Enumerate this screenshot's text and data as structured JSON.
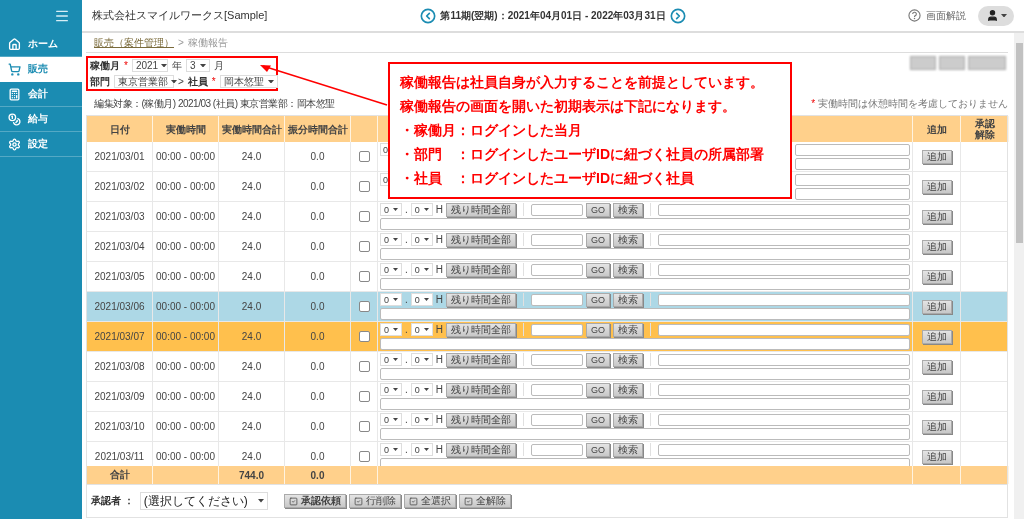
{
  "sidebar": {
    "items": [
      {
        "label": "ホーム",
        "selected": false
      },
      {
        "label": "販売",
        "selected": true
      },
      {
        "label": "会計",
        "selected": false
      },
      {
        "label": "給与",
        "selected": false
      },
      {
        "label": "設定",
        "selected": false
      }
    ]
  },
  "header": {
    "company": "株式会社スマイルワークス[Sample]",
    "period": "第11期(翌期)：2021年04月01日 - 2022年03月31日",
    "help": "画面解説"
  },
  "breadcrumb": {
    "link": "販売（案件管理）",
    "separator": ">",
    "current": "稼働報告"
  },
  "filters": {
    "month_label": "稼働月",
    "month_required": "*",
    "year": "2021",
    "year_unit": "年",
    "month": "3",
    "month_unit": "月",
    "dept_label": "部門",
    "dept": "東京営業部",
    "separator": ">",
    "employee_label": "社員",
    "employee_required": "*",
    "employee": "岡本悠聖"
  },
  "edit_target": "編集対象：(稼働月) 2021/03 (社員) 東京営業部：岡本悠聖",
  "note": {
    "mark": "*",
    "text": "実働時間は休憩時間を考慮しておりません"
  },
  "table": {
    "columns": [
      {
        "label": "日付"
      },
      {
        "label": "実働時間"
      },
      {
        "label": "実働時間合計"
      },
      {
        "label": "振分時間合計"
      },
      {
        "label": "追加"
      },
      {
        "label": "承認解除"
      }
    ],
    "rows": [
      {
        "date": "2021/03/01",
        "work_time": "00:00 - 00:00",
        "total": "24.0",
        "allocated": "0.0",
        "checked": false,
        "hovered": false,
        "selected": false,
        "hours": "0",
        "add_button": "追加"
      },
      {
        "date": "2021/03/02",
        "work_time": "00:00 - 00:00",
        "total": "24.0",
        "allocated": "0.0",
        "checked": false,
        "hovered": false,
        "selected": false,
        "hours": "0",
        "add_button": "追加"
      },
      {
        "date": "2021/03/03",
        "work_time": "00:00 - 00:00",
        "total": "24.0",
        "allocated": "0.0",
        "checked": false,
        "hovered": false,
        "selected": false,
        "hours": "0",
        "dot": ".",
        "minutes": "0",
        "unit": "H",
        "fill_button": "残り時間全部",
        "go_button": "GO",
        "search_button": "検索",
        "add_button": "追加"
      },
      {
        "date": "2021/03/04",
        "work_time": "00:00 - 00:00",
        "total": "24.0",
        "allocated": "0.0",
        "checked": false,
        "hovered": false,
        "selected": false,
        "hours": "0",
        "dot": ".",
        "minutes": "0",
        "unit": "H",
        "fill_button": "残り時間全部",
        "go_button": "GO",
        "search_button": "検索",
        "add_button": "追加"
      },
      {
        "date": "2021/03/05",
        "work_time": "00:00 - 00:00",
        "total": "24.0",
        "allocated": "0.0",
        "checked": false,
        "hovered": false,
        "selected": false,
        "hours": "0",
        "dot": ".",
        "minutes": "0",
        "unit": "H",
        "fill_button": "残り時間全部",
        "go_button": "GO",
        "search_button": "検索",
        "add_button": "追加"
      },
      {
        "date": "2021/03/06",
        "work_time": "00:00 - 00:00",
        "total": "24.0",
        "allocated": "0.0",
        "checked": false,
        "hovered": true,
        "selected": false,
        "hours": "0",
        "dot": ".",
        "minutes": "0",
        "unit": "H",
        "fill_button": "残り時間全部",
        "go_button": "GO",
        "search_button": "検索",
        "add_button": "追加"
      },
      {
        "date": "2021/03/07",
        "work_time": "00:00 - 00:00",
        "total": "24.0",
        "allocated": "0.0",
        "checked": false,
        "hovered": false,
        "selected": true,
        "hours": "0",
        "dot": ".",
        "minutes": "0",
        "unit": "H",
        "fill_button": "残り時間全部",
        "go_button": "GO",
        "search_button": "検索",
        "add_button": "追加"
      },
      {
        "date": "2021/03/08",
        "work_time": "00:00 - 00:00",
        "total": "24.0",
        "allocated": "0.0",
        "checked": false,
        "hovered": false,
        "selected": false,
        "hours": "0",
        "dot": ".",
        "minutes": "0",
        "unit": "H",
        "fill_button": "残り時間全部",
        "go_button": "GO",
        "search_button": "検索",
        "add_button": "追加"
      },
      {
        "date": "2021/03/09",
        "work_time": "00:00 - 00:00",
        "total": "24.0",
        "allocated": "0.0",
        "checked": false,
        "hovered": false,
        "selected": false,
        "hours": "0",
        "dot": ".",
        "minutes": "0",
        "unit": "H",
        "fill_button": "残り時間全部",
        "go_button": "GO",
        "search_button": "検索",
        "add_button": "追加"
      },
      {
        "date": "2021/03/10",
        "work_time": "00:00 - 00:00",
        "total": "24.0",
        "allocated": "0.0",
        "checked": false,
        "hovered": false,
        "selected": false,
        "hours": "0",
        "dot": ".",
        "minutes": "0",
        "unit": "H",
        "fill_button": "残り時間全部",
        "go_button": "GO",
        "search_button": "検索",
        "add_button": "追加"
      },
      {
        "date": "2021/03/11",
        "work_time": "00:00 - 00:00",
        "total": "24.0",
        "allocated": "0.0",
        "checked": false,
        "hovered": false,
        "selected": false,
        "hours": "0",
        "dot": ".",
        "minutes": "0",
        "unit": "H",
        "fill_button": "残り時間全部",
        "go_button": "GO",
        "search_button": "検索",
        "add_button": "追加"
      }
    ],
    "total": {
      "label": "合計",
      "total": "744.0",
      "allocated": "0.0"
    }
  },
  "footer": {
    "approver_label": "承認者 ：",
    "approver": "(選択してください)",
    "buttons": [
      {
        "label": "承認依頼",
        "primary": true
      },
      {
        "label": "行削除",
        "primary": false
      },
      {
        "label": "全選択",
        "primary": false
      },
      {
        "label": "全解除",
        "primary": false
      }
    ]
  },
  "callout": {
    "lines": [
      "稼働報告は社員自身が入力することを前提としています。",
      "稼働報告の画面を開いた初期表示は下記になります。",
      "・稼働月：ログインした当月",
      "・部門　：ログインしたユーザIDに紐づく社員の所属部署",
      "・社員　：ログインしたユーザIDに紐づく社員"
    ]
  }
}
